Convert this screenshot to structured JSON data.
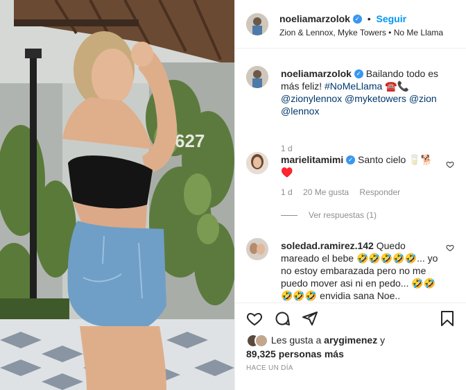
{
  "post": {
    "author": "noeliamarzolok",
    "follow_label": "Seguir",
    "separator": "•",
    "audio": "Zion & Lennox, Myke Towers • No Me Llama"
  },
  "caption": {
    "author": "noeliamarzolok",
    "text_before": "Bailando todo es más feliz! ",
    "hashtag": "#NoMeLlama",
    "emoji": "☎️📞",
    "mentions": "@zionylennox @myketowers @zion @lennox",
    "time": "1 d"
  },
  "comments": [
    {
      "author": "marielitamimi",
      "text": "Santo cielo 🥛🐕 ♥️",
      "time": "1 d",
      "likes": "20 Me gusta",
      "reply_label": "Responder",
      "view_replies": "Ver respuestas (1)"
    },
    {
      "author": "soledad.ramirez.142",
      "text": "Quedo mareado el bebe 🤣🤣🤣🤣🤣... yo no estoy embarazada pero no me puedo mover asi ni en pedo... 🤣🤣🤣🤣🤣 envidia sana Noe.."
    }
  ],
  "likes": {
    "prefix": "Les gusta a ",
    "user": "arygimenez",
    "and": " y",
    "count": "89,325 personas más"
  },
  "time_ago": "HACE UN DÍA",
  "media": {
    "wall_number": "627"
  },
  "colors": {
    "accent": "#0095f6",
    "verified": "#3897f0",
    "muted": "#8e8e8e",
    "hashtag": "#00376b"
  },
  "icons": [
    "heart-icon",
    "comment-icon",
    "share-icon",
    "bookmark-icon",
    "verified-icon"
  ]
}
